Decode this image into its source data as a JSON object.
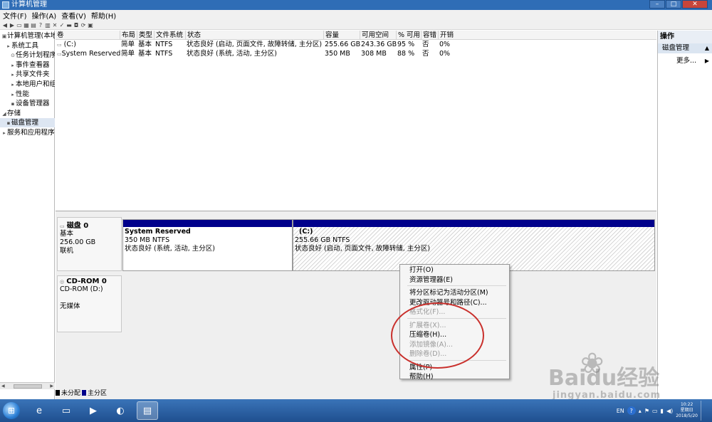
{
  "window": {
    "title": "计算机管理"
  },
  "menu": [
    "文件(F)",
    "操作(A)",
    "查看(V)",
    "帮助(H)"
  ],
  "toolbar_icons": [
    "back-arrow-icon",
    "forward-arrow-icon",
    "up-folder-icon",
    "show-tree-icon",
    "properties-icon",
    "help-icon",
    "list-icon",
    "delete-icon",
    "properties-icon",
    "folder-icon",
    "disk-icon",
    "refresh-icon",
    "view-icon"
  ],
  "nav": [
    {
      "label": "计算机管理(本地)",
      "glyph": "▣",
      "level": 0
    },
    {
      "label": "系统工具",
      "glyph": "▸",
      "level": 1
    },
    {
      "label": "任务计划程序",
      "glyph": "⊙",
      "level": 2
    },
    {
      "label": "事件查看器",
      "glyph": "▸",
      "level": 2
    },
    {
      "label": "共享文件夹",
      "glyph": "▸",
      "level": 2
    },
    {
      "label": "本地用户和组",
      "glyph": "▸",
      "level": 2
    },
    {
      "label": "性能",
      "glyph": "▸",
      "level": 2
    },
    {
      "label": "设备管理器",
      "glyph": "▪",
      "level": 2
    },
    {
      "label": "存储",
      "glyph": "◢",
      "level": 0
    },
    {
      "label": "磁盘管理",
      "glyph": "▪",
      "level": 1,
      "selected": true
    },
    {
      "label": "服务和应用程序",
      "glyph": "▸",
      "level": 0
    }
  ],
  "volume_table": {
    "columns": [
      "卷",
      "布局",
      "类型",
      "文件系统",
      "状态",
      "容量",
      "可用空间",
      "% 可用",
      "容错",
      "开销"
    ],
    "rows": [
      [
        "(C:)",
        "简单",
        "基本",
        "NTFS",
        "状态良好 (启动, 页面文件, 故障转储, 主分区)",
        "255.66 GB",
        "243.36 GB",
        "95 %",
        "否",
        "0%"
      ],
      [
        "System Reserved",
        "简单",
        "基本",
        "NTFS",
        "状态良好 (系统, 活动, 主分区)",
        "350 MB",
        "308 MB",
        "88 %",
        "否",
        "0%"
      ]
    ]
  },
  "disk0": {
    "name": "磁盘 0",
    "type": "基本",
    "size": "256.00 GB",
    "status": "联机",
    "partitions": [
      {
        "name": "System Reserved",
        "size": "350 MB NTFS",
        "status": "状态良好 (系统, 活动, 主分区)"
      },
      {
        "name": "(C:)",
        "size": "255.66 GB NTFS",
        "status": "状态良好 (启动, 页面文件, 故障转储, 主分区)"
      }
    ]
  },
  "cdrom0": {
    "name": "CD-ROM 0",
    "type": "CD-ROM (D:)",
    "status": "无媒体"
  },
  "legend": [
    {
      "label": "未分配",
      "color": "#000000"
    },
    {
      "label": "主分区",
      "color": "#00008b"
    }
  ],
  "actions": {
    "header": "操作",
    "section": "磁盘管理",
    "more": "更多..."
  },
  "context_menu": [
    {
      "label": "打开(O)",
      "enabled": true
    },
    {
      "label": "资源管理器(E)",
      "enabled": true
    },
    {
      "sep": true
    },
    {
      "label": "将分区标记为活动分区(M)",
      "enabled": true
    },
    {
      "label": "更改驱动器号和路径(C)...",
      "enabled": true
    },
    {
      "label": "格式化(F)...",
      "enabled": false
    },
    {
      "sep": true
    },
    {
      "label": "扩展卷(X)...",
      "enabled": false
    },
    {
      "label": "压缩卷(H)...",
      "enabled": true
    },
    {
      "label": "添加镜像(A)...",
      "enabled": false
    },
    {
      "label": "删除卷(D)...",
      "enabled": false
    },
    {
      "sep": true
    },
    {
      "label": "属性(P)",
      "enabled": true
    },
    {
      "label": "帮助(H)",
      "enabled": true
    }
  ],
  "taskbar": {
    "apps": [
      {
        "name": "ie-icon",
        "glyph": "e"
      },
      {
        "name": "explorer-folder-icon",
        "glyph": "▭"
      },
      {
        "name": "media-player-icon",
        "glyph": "▶"
      },
      {
        "name": "chat-icon",
        "glyph": "◐"
      },
      {
        "name": "computer-management-icon",
        "glyph": "▤",
        "active": true
      }
    ],
    "lang": "EN",
    "clock": {
      "time": "10:22",
      "day": "星期日",
      "date": "2018/5/20"
    }
  },
  "watermark": {
    "big": "Baidu经验",
    "small": "jingyan.baidu.com"
  }
}
